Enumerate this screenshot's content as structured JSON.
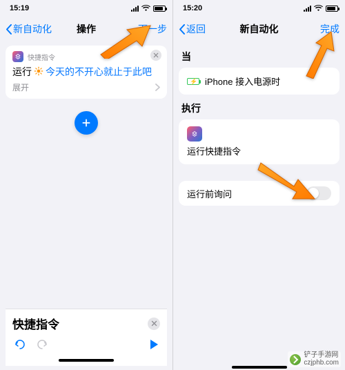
{
  "left": {
    "status": {
      "time": "15:19",
      "signal_icon": "cell-signal",
      "wifi_icon": "wifi",
      "battery_icon": "battery"
    },
    "nav": {
      "back": "新自动化",
      "title": "操作",
      "next": "下一步"
    },
    "card": {
      "app_label": "快捷指令",
      "run_label": "运行",
      "sun_icon": "sun",
      "link_text": "今天的不开心就止于此吧",
      "expand": "展开"
    },
    "add_icon": "plus",
    "suggest": {
      "title": "快捷指令",
      "close_icon": "close",
      "undo_icon": "undo",
      "redo_icon": "redo",
      "play_icon": "play"
    }
  },
  "right": {
    "status": {
      "time": "15:20"
    },
    "nav": {
      "back": "返回",
      "title": "新自动化",
      "done": "完成"
    },
    "when": {
      "label": "当",
      "row_text": "iPhone 接入电源时"
    },
    "do": {
      "label": "执行",
      "action_text": "运行快捷指令"
    },
    "ask": {
      "label": "运行前询问",
      "value": false
    }
  },
  "watermark": {
    "line1": "铲子手游网",
    "line2": "czjphb.com"
  }
}
